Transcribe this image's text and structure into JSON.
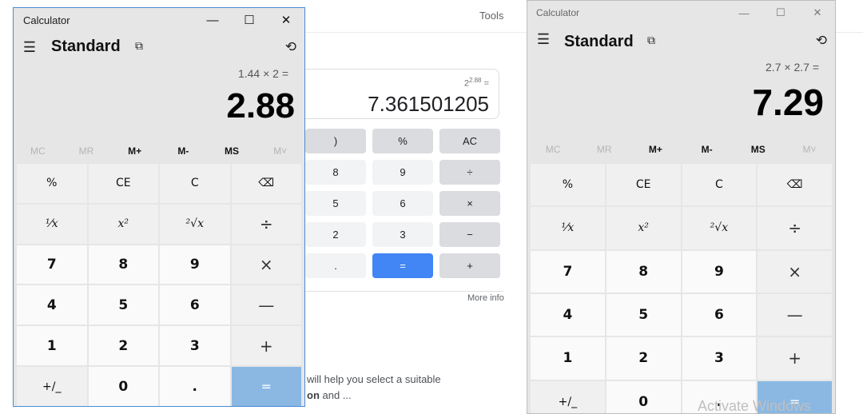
{
  "background": {
    "tools_label": "Tools",
    "display_expression_base": "2",
    "display_expression_exp": "2.88",
    "display_expression_suffix": " =",
    "display_result": "7.361501205",
    "buttons": [
      {
        "label": ")",
        "row": 0,
        "col": 0,
        "kind": "op"
      },
      {
        "label": "%",
        "row": 0,
        "col": 1,
        "kind": "op"
      },
      {
        "label": "AC",
        "row": 0,
        "col": 2,
        "kind": "op"
      },
      {
        "label": "8",
        "row": 1,
        "col": 0,
        "kind": "num"
      },
      {
        "label": "9",
        "row": 1,
        "col": 1,
        "kind": "num"
      },
      {
        "label": "÷",
        "row": 1,
        "col": 2,
        "kind": "op"
      },
      {
        "label": "5",
        "row": 2,
        "col": 0,
        "kind": "num"
      },
      {
        "label": "6",
        "row": 2,
        "col": 1,
        "kind": "num"
      },
      {
        "label": "×",
        "row": 2,
        "col": 2,
        "kind": "op"
      },
      {
        "label": "2",
        "row": 3,
        "col": 0,
        "kind": "num"
      },
      {
        "label": "3",
        "row": 3,
        "col": 1,
        "kind": "num"
      },
      {
        "label": "−",
        "row": 3,
        "col": 2,
        "kind": "op"
      },
      {
        "label": ".",
        "row": 4,
        "col": 0,
        "kind": "num"
      },
      {
        "label": "=",
        "row": 4,
        "col": 1,
        "kind": "eq"
      },
      {
        "label": "+",
        "row": 4,
        "col": 2,
        "kind": "op"
      }
    ],
    "more_info": "More info",
    "snippet_line1": "will help you select a suitable",
    "snippet_line2_bold": "on",
    "snippet_line2_rest": " and ..."
  },
  "calc_left": {
    "title": "Calculator",
    "mode": "Standard",
    "expression": "1.44 × 2 =",
    "result": "2.88",
    "memory": [
      "MC",
      "MR",
      "M+",
      "M-",
      "MS",
      "M˅"
    ],
    "memory_enabled": [
      false,
      false,
      true,
      true,
      true,
      false
    ]
  },
  "calc_right": {
    "title": "Calculator",
    "mode": "Standard",
    "expression": "2.7 × 2.7 =",
    "result": "7.29",
    "memory": [
      "MC",
      "MR",
      "M+",
      "M-",
      "MS",
      "M˅"
    ],
    "memory_enabled": [
      false,
      false,
      true,
      true,
      true,
      false
    ]
  },
  "keypad": [
    {
      "label": "%",
      "name": "percent-button",
      "kind": "fn"
    },
    {
      "label": "CE",
      "name": "clear-entry-button",
      "kind": "fn"
    },
    {
      "label": "C",
      "name": "clear-button",
      "kind": "fn"
    },
    {
      "label": "⌫",
      "name": "backspace-button",
      "kind": "fn"
    },
    {
      "label": "¹⁄x",
      "name": "reciprocal-button",
      "kind": "fn",
      "italic": true
    },
    {
      "label": "x²",
      "name": "square-button",
      "kind": "fn",
      "italic": true
    },
    {
      "label": "²√x",
      "name": "square-root-button",
      "kind": "fn",
      "italic": true
    },
    {
      "label": "÷",
      "name": "divide-button",
      "kind": "op"
    },
    {
      "label": "7",
      "name": "digit-7-button",
      "kind": "num"
    },
    {
      "label": "8",
      "name": "digit-8-button",
      "kind": "num"
    },
    {
      "label": "9",
      "name": "digit-9-button",
      "kind": "num"
    },
    {
      "label": "×",
      "name": "multiply-button",
      "kind": "op"
    },
    {
      "label": "4",
      "name": "digit-4-button",
      "kind": "num"
    },
    {
      "label": "5",
      "name": "digit-5-button",
      "kind": "num"
    },
    {
      "label": "6",
      "name": "digit-6-button",
      "kind": "num"
    },
    {
      "label": "—",
      "name": "subtract-button",
      "kind": "op"
    },
    {
      "label": "1",
      "name": "digit-1-button",
      "kind": "num"
    },
    {
      "label": "2",
      "name": "digit-2-button",
      "kind": "num"
    },
    {
      "label": "3",
      "name": "digit-3-button",
      "kind": "num"
    },
    {
      "label": "+",
      "name": "add-button",
      "kind": "op"
    },
    {
      "label": "+/_",
      "name": "negate-button",
      "kind": "fn"
    },
    {
      "label": "0",
      "name": "digit-0-button",
      "kind": "num"
    },
    {
      "label": ".",
      "name": "decimal-button",
      "kind": "num"
    },
    {
      "label": "=",
      "name": "equals-button",
      "kind": "eq"
    }
  ],
  "window_controls": {
    "minimize": "—",
    "maximize": "☐",
    "close": "✕"
  },
  "watermark": "Activate Windows"
}
